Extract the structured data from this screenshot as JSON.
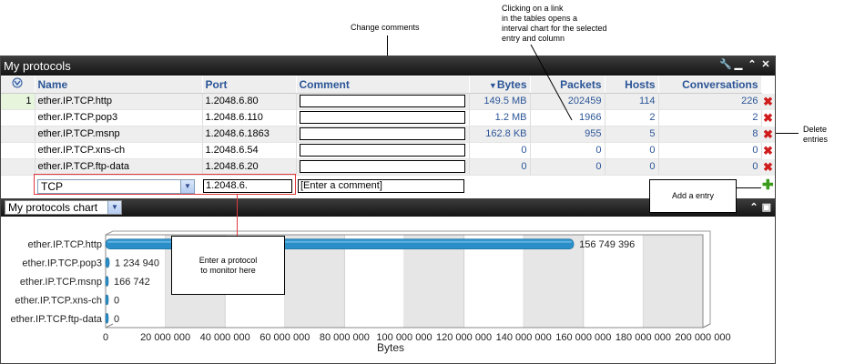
{
  "annotations": {
    "change_comments": "Change comments",
    "clicking_link": "Clicking on a link\nin the tables opens a\ninterval chart for the selected\nentry and column",
    "delete_entries": "Delete\nentries",
    "add_entry": "Add a entry",
    "enter_protocol": "Enter a protocol\nto monitor here"
  },
  "panel": {
    "title": "My protocols",
    "icons": [
      "wrench-icon",
      "minimize-icon",
      "collapse-icon",
      "close-icon"
    ]
  },
  "table": {
    "headers": {
      "name": "Name",
      "port": "Port",
      "comment": "Comment",
      "bytes": "Bytes",
      "packets": "Packets",
      "hosts": "Hosts",
      "conversations": "Conversations"
    },
    "rows": [
      {
        "idx": "1",
        "name": "ether.IP.TCP.http",
        "port": "1.2048.6.80",
        "bytes": "149.5 MB",
        "packets": "202459",
        "hosts": "114",
        "conversations": "226"
      },
      {
        "idx": "",
        "name": "ether.IP.TCP.pop3",
        "port": "1.2048.6.110",
        "bytes": "1.2 MB",
        "packets": "1966",
        "hosts": "2",
        "conversations": "2"
      },
      {
        "idx": "",
        "name": "ether.IP.TCP.msnp",
        "port": "1.2048.6.1863",
        "bytes": "162.8 KB",
        "packets": "955",
        "hosts": "5",
        "conversations": "8"
      },
      {
        "idx": "",
        "name": "ether.IP.TCP.xns-ch",
        "port": "1.2048.6.54",
        "bytes": "0",
        "packets": "0",
        "hosts": "0",
        "conversations": "0"
      },
      {
        "idx": "",
        "name": "ether.IP.TCP.ftp-data",
        "port": "1.2048.6.20",
        "bytes": "0",
        "packets": "0",
        "hosts": "0",
        "conversations": "0"
      }
    ],
    "new_entry": {
      "protocol_value": "TCP",
      "port_value": "1.2048.6.",
      "comment_placeholder": "[Enter a comment]"
    }
  },
  "chart_panel": {
    "selected_chart": "My protocols chart"
  },
  "chart_data": {
    "type": "bar",
    "orientation": "horizontal",
    "categories": [
      "ether.IP.TCP.http",
      "ether.IP.TCP.pop3",
      "ether.IP.TCP.msnp",
      "ether.IP.TCP.xns-ch",
      "ether.IP.TCP.ftp-data"
    ],
    "values": [
      156749396,
      1234940,
      166742,
      0,
      0
    ],
    "value_labels": [
      "156 749 396",
      "1 234 940",
      "166 742",
      "0",
      "0"
    ],
    "xlabel": "Bytes",
    "xlim": [
      0,
      200000000
    ],
    "xticks": [
      "0",
      "20 000 000",
      "40 000 000",
      "60 000 000",
      "80 000 000",
      "100 000 000",
      "120 000 000",
      "140 000 000",
      "160 000 000",
      "180 000 000",
      "200 000 000"
    ],
    "bar_color": "#2a8fc9"
  }
}
